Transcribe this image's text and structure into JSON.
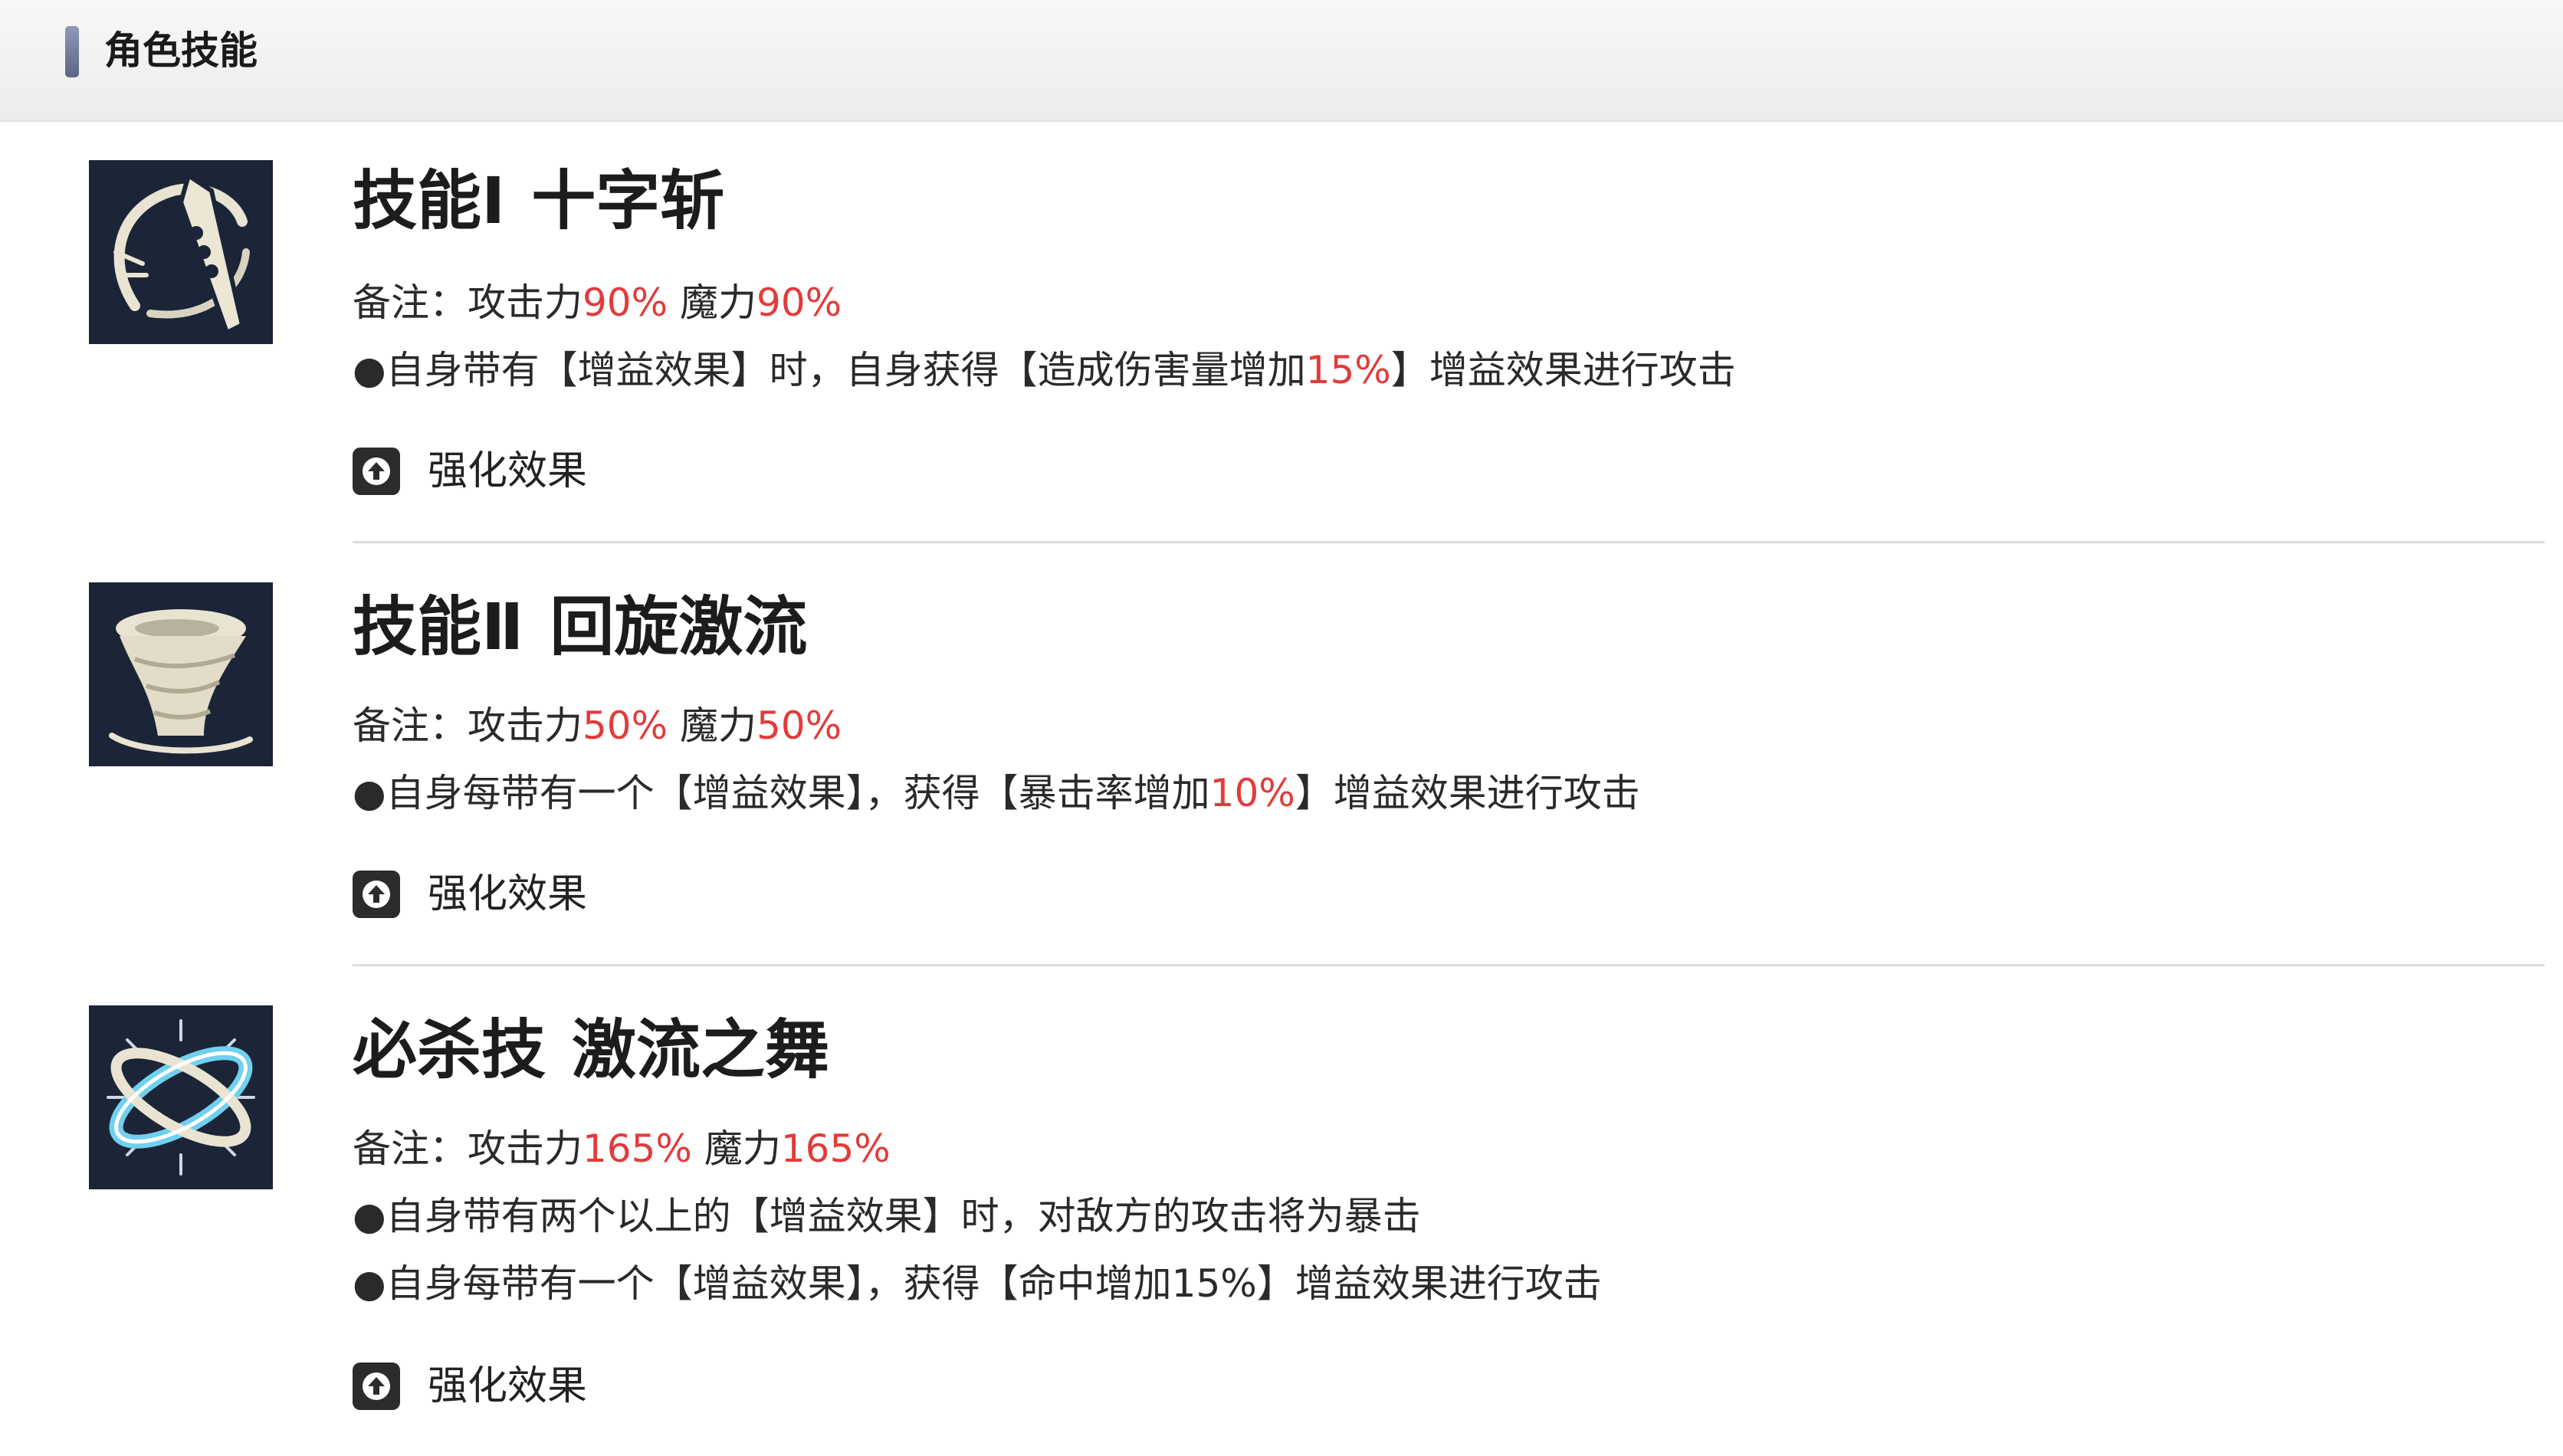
{
  "header": {
    "title": "角色技能"
  },
  "skills": [
    {
      "name_prefix": "技能Ⅰ",
      "name": "十字斩",
      "note_label": "备注：攻击力",
      "atk": "90%",
      "mag_label": "魔力",
      "mag": "90%",
      "effects": [
        {
          "pre": "●自身带有【增益效果】时，自身获得【造成伤害量增加",
          "val": "15%",
          "post": "】增益效果进行攻击"
        }
      ],
      "enhance_label": "强化效果",
      "icon": "cross-slash-icon"
    },
    {
      "name_prefix": "技能Ⅱ",
      "name": "回旋激流",
      "note_label": "备注：攻击力",
      "atk": "50%",
      "mag_label": "魔力",
      "mag": "50%",
      "effects": [
        {
          "pre": "●自身每带有一个【增益效果】，获得【暴击率增加",
          "val": "10%",
          "post": "】增益效果进行攻击"
        }
      ],
      "enhance_label": "强化效果",
      "icon": "whirlwind-icon"
    },
    {
      "name_prefix": "必杀技",
      "name": "激流之舞",
      "note_label": "备注：攻击力",
      "atk": "165%",
      "mag_label": "魔力",
      "mag": "165%",
      "effects": [
        {
          "pre": "●自身带有两个以上的【增益效果】时，对敌方的攻击将为暴击",
          "val": "",
          "post": ""
        },
        {
          "pre": "●自身每带有一个【增益效果】，获得【命中增加15%】增益效果进行攻击",
          "val": "",
          "post": ""
        }
      ],
      "enhance_label": "强化效果",
      "icon": "torrent-dance-icon"
    }
  ],
  "colors": {
    "highlight": "#e23b3b",
    "header_accent": "#6b7594",
    "icon_bg": "#1c2638"
  }
}
